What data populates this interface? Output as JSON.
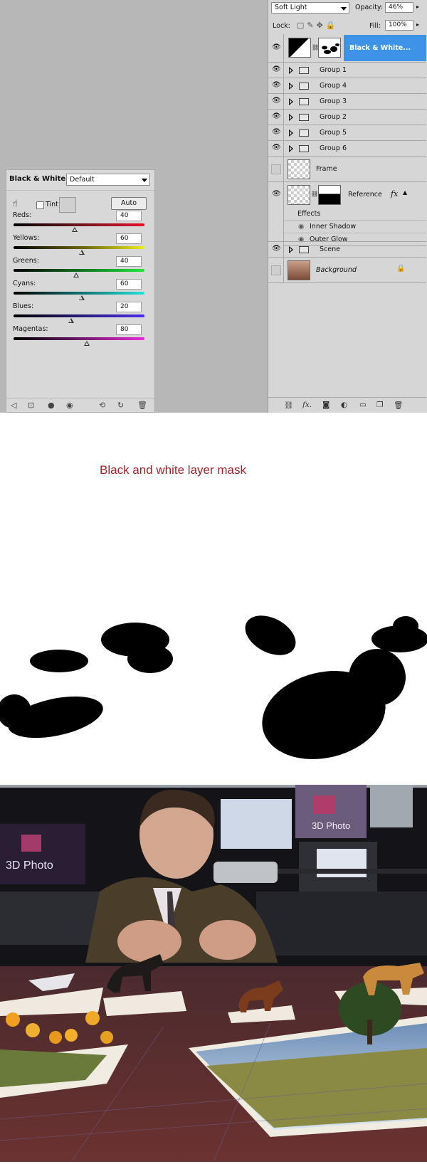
{
  "adjustment_panel": {
    "title": "Black & White",
    "preset": "Default",
    "tint_label": "Tint",
    "auto_label": "Auto",
    "sliders": [
      {
        "label": "Reds:",
        "value": "40",
        "fraction": 0.47
      },
      {
        "label": "Yellows:",
        "value": "60",
        "fraction": 0.52
      },
      {
        "label": "Greens:",
        "value": "40",
        "fraction": 0.48
      },
      {
        "label": "Cyans:",
        "value": "60",
        "fraction": 0.52
      },
      {
        "label": "Blues:",
        "value": "20",
        "fraction": 0.44
      },
      {
        "label": "Magentas:",
        "value": "80",
        "fraction": 0.56
      }
    ]
  },
  "layers_panel": {
    "blend_mode": "Soft Light",
    "opacity_label": "Opacity:",
    "opacity": "46%",
    "lock_label": "Lock:",
    "fill_label": "Fill:",
    "fill": "100%",
    "layers": [
      {
        "name": "Black & White..."
      },
      {
        "name": "Group 1"
      },
      {
        "name": "Group 4"
      },
      {
        "name": "Group 3"
      },
      {
        "name": "Group 2"
      },
      {
        "name": "Group 5"
      },
      {
        "name": "Group 6"
      },
      {
        "name": "Frame"
      },
      {
        "name": "Reference",
        "fx": "fx"
      },
      {
        "name": "Effects"
      },
      {
        "name": "Inner Shadow"
      },
      {
        "name": "Outer Glow"
      },
      {
        "name": "Scene"
      },
      {
        "name": "Background"
      }
    ]
  },
  "mask_section": {
    "caption": "Black and white layer mask"
  },
  "photo": {
    "screen_text_left": "3D Photo",
    "screen_text_right": "3D Photo"
  },
  "colors": {
    "panel_bg": "#d8d8d8",
    "selected_layer": "#3d93e8",
    "caption_red": "#a5222a"
  }
}
